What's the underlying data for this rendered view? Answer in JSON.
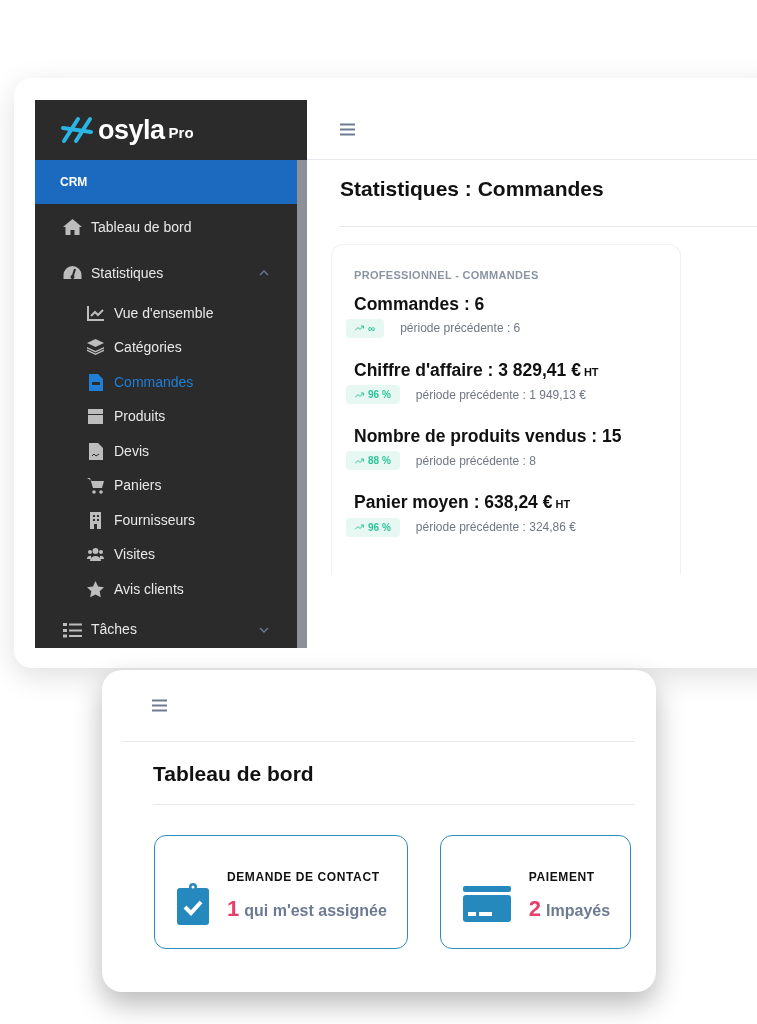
{
  "logo": {
    "name": "osyla",
    "suffix": "Pro"
  },
  "sidebar": {
    "section": "CRM",
    "items": [
      {
        "label": "Tableau de bord",
        "selected": false
      },
      {
        "label": "Statistiques",
        "selected": false,
        "expanded": true,
        "children": [
          {
            "label": "Vue d'ensemble",
            "selected": false
          },
          {
            "label": "Catégories",
            "selected": false
          },
          {
            "label": "Commandes",
            "selected": true
          },
          {
            "label": "Produits",
            "selected": false
          },
          {
            "label": "Devis",
            "selected": false
          },
          {
            "label": "Paniers",
            "selected": false
          },
          {
            "label": "Fournisseurs",
            "selected": false
          },
          {
            "label": "Visites",
            "selected": false
          },
          {
            "label": "Avis clients",
            "selected": false
          }
        ]
      },
      {
        "label": "Tâches",
        "selected": false,
        "expanded": false
      }
    ]
  },
  "main": {
    "title": "Statistiques : Commandes",
    "card": {
      "heading": "PROFESSIONNEL - COMMANDES",
      "stats": [
        {
          "label": "Commandes : 6",
          "trend": "∞",
          "previous": "période précédente : 6"
        },
        {
          "label": "Chiffre d'affaire : 3 829,41 €",
          "unit": "HT",
          "trend": "96 %",
          "previous": "période précédente : 1 949,13 €"
        },
        {
          "label": "Nombre de produits vendus : 15",
          "trend": "88 %",
          "previous": "période précédente : 8"
        },
        {
          "label": "Panier moyen : 638,24 €",
          "unit": "HT",
          "trend": "96 %",
          "previous": "période précédente : 324,86 €"
        }
      ]
    }
  },
  "dashboard": {
    "title": "Tableau de bord",
    "tiles": [
      {
        "title": "DEMANDE DE CONTACT",
        "count": "1",
        "text": "qui m'est assignée"
      },
      {
        "title": "PAIEMENT",
        "count": "2",
        "text": "Impayés"
      }
    ]
  }
}
